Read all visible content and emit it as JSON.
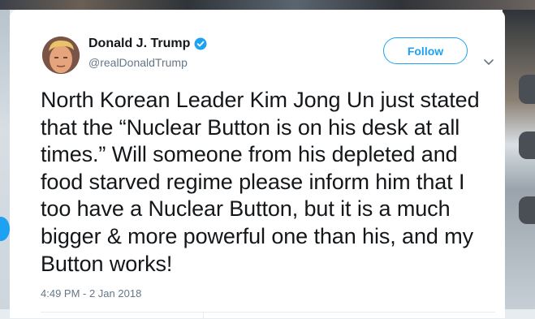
{
  "tweet": {
    "author_name": "Donald J. Trump",
    "author_handle": "@realDonaldTrump",
    "follow_label": "Follow",
    "text": "North Korean Leader Kim Jong Un just stated that the “Nuclear Button is on his desk at all times.” Will someone from his depleted and food starved regime please inform him that I too have a Nuclear Button, but it is a much bigger & more powerful one than his, and my Button works!",
    "timestamp": "4:49 PM - 2 Jan 2018",
    "verified": true
  },
  "icons": {
    "verified": "verified-badge-icon",
    "more": "chevron-down-icon"
  },
  "colors": {
    "accent": "#1da1f2",
    "text": "#14171a",
    "muted": "#657786",
    "background": "#e6ecf0"
  }
}
